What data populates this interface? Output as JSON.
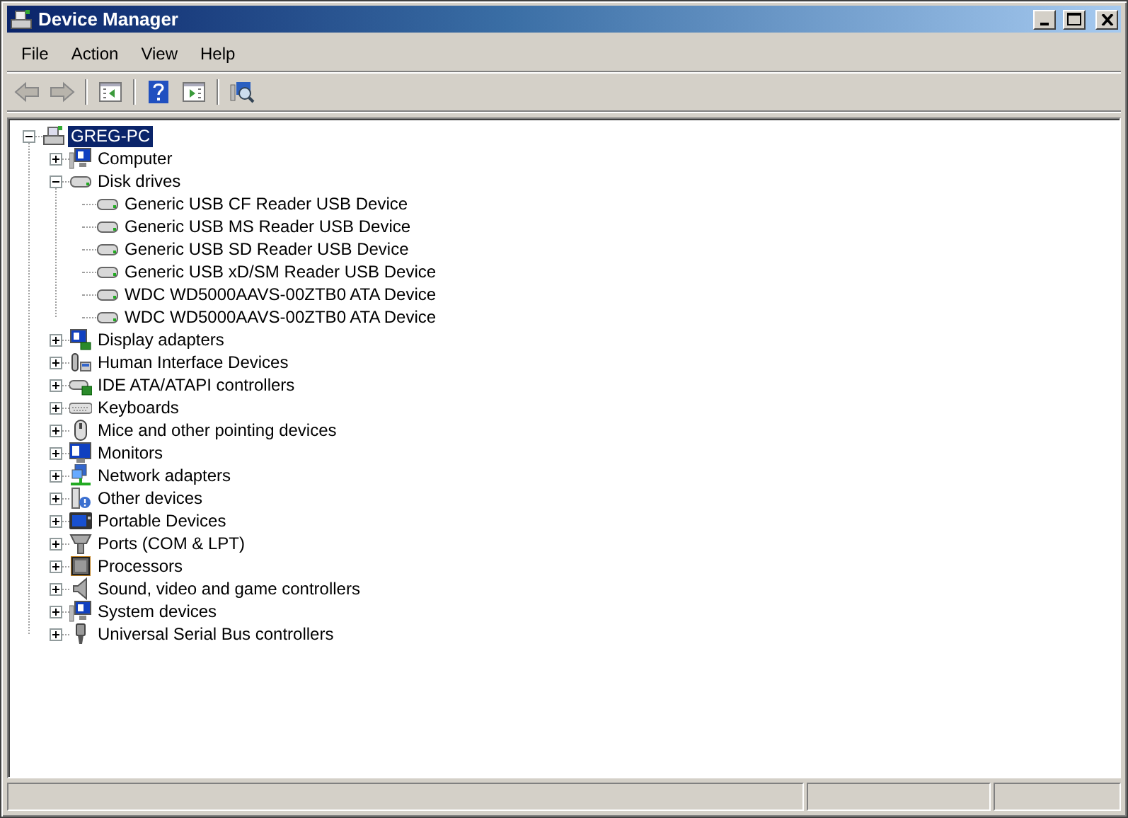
{
  "window": {
    "title": "Device Manager"
  },
  "menu": [
    {
      "label": "File"
    },
    {
      "label": "Action"
    },
    {
      "label": "View"
    },
    {
      "label": "Help"
    }
  ],
  "toolbar": [
    {
      "kind": "back",
      "disabled": true
    },
    {
      "kind": "forward",
      "disabled": true
    },
    {
      "kind": "separator"
    },
    {
      "kind": "console",
      "disabled": false
    },
    {
      "kind": "separator"
    },
    {
      "kind": "help",
      "disabled": false
    },
    {
      "kind": "pane",
      "disabled": false
    },
    {
      "kind": "separator"
    },
    {
      "kind": "scan",
      "disabled": false
    }
  ],
  "tree": {
    "label": "GREG-PC",
    "kind": "computer",
    "expanded": true,
    "selected": true,
    "children": [
      {
        "label": "Computer",
        "kind": "system",
        "expanded": false,
        "selected": false
      },
      {
        "label": "Disk drives",
        "kind": "disk",
        "expanded": true,
        "selected": false,
        "children": [
          {
            "label": "Generic USB CF Reader USB Device",
            "kind": "disk",
            "selected": false
          },
          {
            "label": "Generic USB MS Reader USB Device",
            "kind": "disk",
            "selected": false
          },
          {
            "label": "Generic USB SD Reader USB Device",
            "kind": "disk",
            "selected": false
          },
          {
            "label": "Generic USB xD/SM Reader USB Device",
            "kind": "disk",
            "selected": false
          },
          {
            "label": "WDC WD5000AAVS-00ZTB0 ATA Device",
            "kind": "disk",
            "selected": false
          },
          {
            "label": "WDC WD5000AAVS-00ZTB0 ATA Device",
            "kind": "disk",
            "selected": false
          }
        ]
      },
      {
        "label": "Display adapters",
        "kind": "display",
        "expanded": false,
        "selected": false
      },
      {
        "label": "Human Interface Devices",
        "kind": "hid",
        "expanded": false,
        "selected": false
      },
      {
        "label": "IDE ATA/ATAPI controllers",
        "kind": "ide",
        "expanded": false,
        "selected": false
      },
      {
        "label": "Keyboards",
        "kind": "keyboard",
        "expanded": false,
        "selected": false
      },
      {
        "label": "Mice and other pointing devices",
        "kind": "mouse",
        "expanded": false,
        "selected": false
      },
      {
        "label": "Monitors",
        "kind": "monitor",
        "expanded": false,
        "selected": false
      },
      {
        "label": "Network adapters",
        "kind": "network",
        "expanded": false,
        "selected": false
      },
      {
        "label": "Other devices",
        "kind": "other",
        "expanded": false,
        "selected": false
      },
      {
        "label": "Portable Devices",
        "kind": "portable",
        "expanded": false,
        "selected": false
      },
      {
        "label": "Ports (COM & LPT)",
        "kind": "ports",
        "expanded": false,
        "selected": false
      },
      {
        "label": "Processors",
        "kind": "processor",
        "expanded": false,
        "selected": false
      },
      {
        "label": "Sound, video and game controllers",
        "kind": "sound",
        "expanded": false,
        "selected": false
      },
      {
        "label": "System devices",
        "kind": "system",
        "expanded": false,
        "selected": false
      },
      {
        "label": "Universal Serial Bus controllers",
        "kind": "usb",
        "expanded": false,
        "selected": false
      }
    ]
  }
}
